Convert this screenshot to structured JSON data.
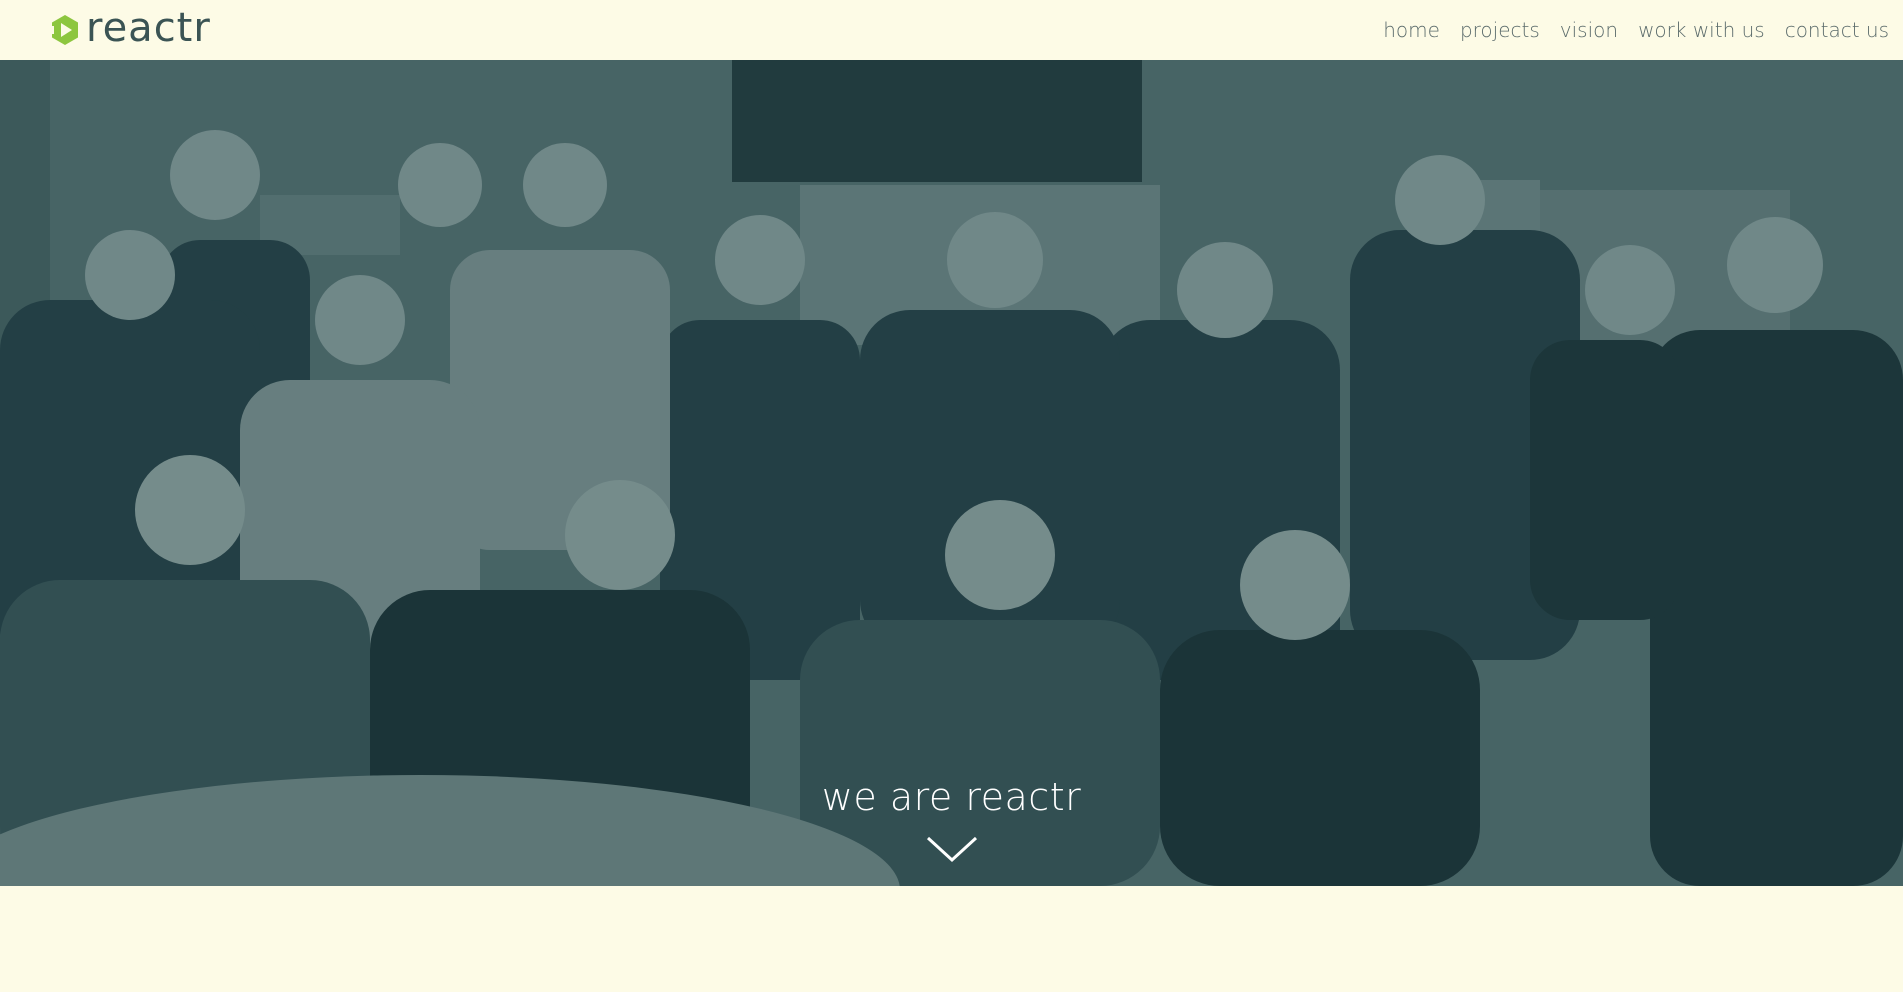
{
  "brand": {
    "name": "reactr",
    "logo_icon": "reactr-hexagon-play-icon",
    "accent_color": "#8dc63f",
    "text_color": "#3b5454"
  },
  "nav": {
    "items": [
      {
        "label": "home"
      },
      {
        "label": "projects"
      },
      {
        "label": "vision"
      },
      {
        "label": "work with us"
      },
      {
        "label": "contact us"
      }
    ]
  },
  "hero": {
    "title": "we are reactr",
    "scroll_icon": "chevron-down-icon",
    "overlay_color": "#1c383c",
    "image_subject": "team group photo"
  },
  "colors": {
    "page_background": "#fdfbe6"
  }
}
